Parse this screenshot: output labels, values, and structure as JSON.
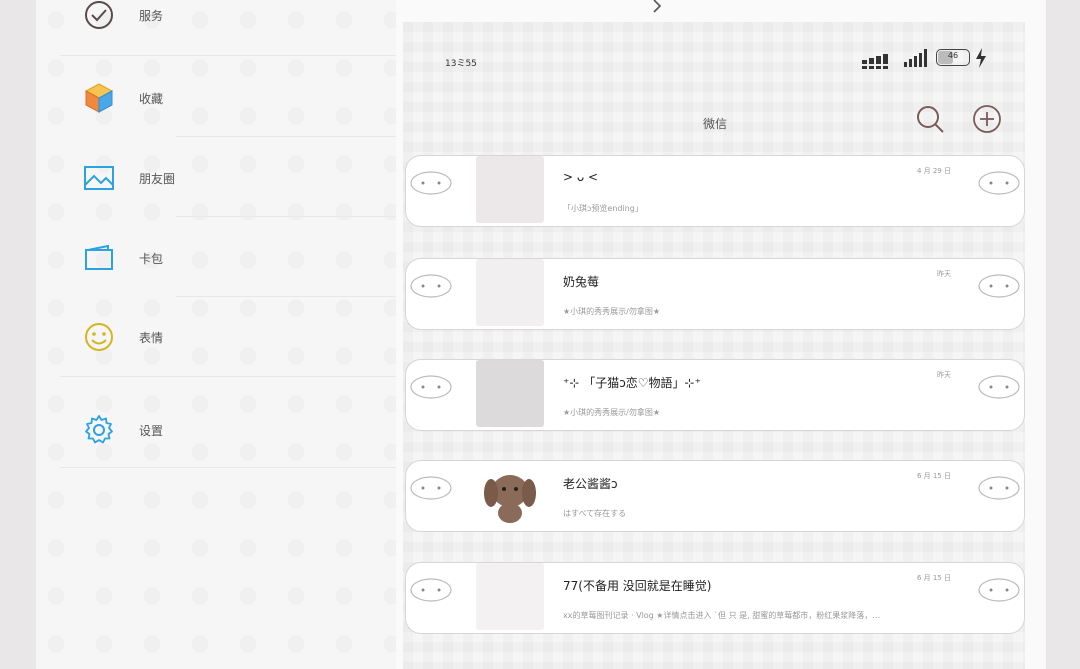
{
  "menu": {
    "items": [
      {
        "label": "服务",
        "icon": "wechat-pay-icon"
      },
      {
        "label": "收藏",
        "icon": "cube-icon"
      },
      {
        "label": "朋友圈",
        "icon": "album-icon"
      },
      {
        "label": "卡包",
        "icon": "wallet-icon"
      },
      {
        "label": "表情",
        "icon": "smiley-icon"
      },
      {
        "label": "设置",
        "icon": "gear-icon"
      }
    ]
  },
  "status": {
    "time": "13ミ55",
    "battery": "46"
  },
  "header": {
    "title": "微信"
  },
  "chats": [
    {
      "name": "> ᴗ <",
      "preview": "「小琪ↄ预览ending」",
      "time": "4 月 29 日"
    },
    {
      "name": "奶兔莓",
      "preview": "★小琪的秀秀展示/勿拿图★",
      "time": "昨天"
    },
    {
      "name": "⁺⊹ 「子猫ↄ恋♡物語」⊹⁺",
      "preview": "★小琪的秀秀展示/勿拿图★",
      "time": "昨天"
    },
    {
      "name": "老公酱酱ↄ",
      "preview": "はすべて存在する",
      "time": "6 月 15 日"
    },
    {
      "name": "77(不备用 没回就是在睡觉)",
      "preview": "xx的草莓图刊记录  ·  Vlog  ★详情点击进入 `但 只 是, 甜蜜的草莓都市，粉红果浆降落，…",
      "time": "6 月 15 日"
    }
  ],
  "colors": {
    "wechat_pay": "#5a4a4a",
    "cube": "#f2b134",
    "album": "#2aa3e0",
    "wallet": "#2aa3e0",
    "smiley": "#d4b51f",
    "gear": "#2aa3e0"
  }
}
